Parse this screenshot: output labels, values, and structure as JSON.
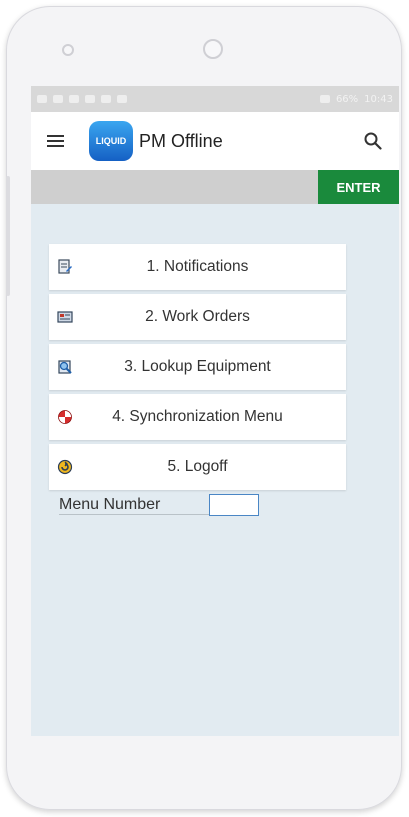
{
  "statusbar": {
    "time": "10:43",
    "battery": "66%"
  },
  "app": {
    "logo_text": "LIQUID",
    "title": "PM Offline"
  },
  "toolbar": {
    "enter_label": "ENTER"
  },
  "menu": {
    "items": [
      {
        "label": "1. Notifications",
        "icon": "notification-icon"
      },
      {
        "label": "2. Work Orders",
        "icon": "work-orders-icon"
      },
      {
        "label": "3. Lookup Equipment",
        "icon": "lookup-equipment-icon"
      },
      {
        "label": "4. Synchronization Menu",
        "icon": "synchronization-icon"
      },
      {
        "label": "5. Logoff",
        "icon": "logoff-icon"
      }
    ]
  },
  "menu_number": {
    "label": "Menu Number",
    "value": ""
  },
  "colors": {
    "enter_green": "#1a8a3c",
    "screen_bg": "#e2ebf1",
    "logo_blue": "#1f7fe0"
  }
}
